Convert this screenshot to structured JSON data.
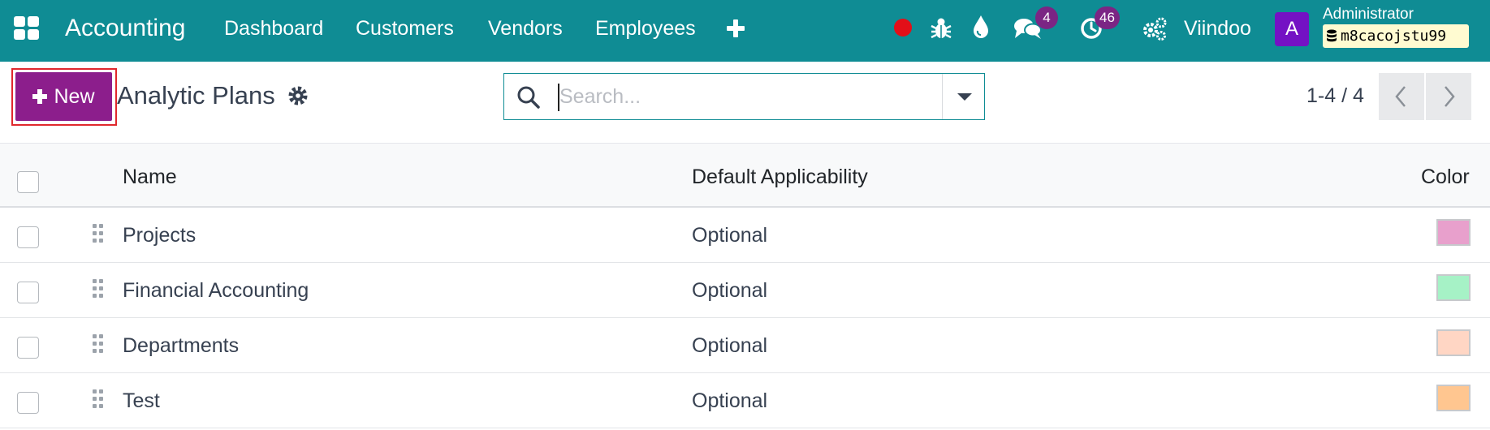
{
  "navbar": {
    "app_name": "Accounting",
    "menu": [
      "Dashboard",
      "Customers",
      "Vendors",
      "Employees"
    ],
    "icons": [
      "apps-grid-icon",
      "plus-icon",
      "record-dot-icon",
      "bug-icon",
      "drop-icon",
      "chat-icon",
      "clock-icon",
      "settings-gears-icon"
    ],
    "messages_count": "4",
    "activities_count": "46",
    "company": "Viindoo",
    "avatar_letter": "A",
    "user": "Administrator",
    "database": "m8cacojstu99",
    "colors": {
      "bar": "#0f8c94",
      "badge": "#7b2584",
      "avatar": "#7411c4",
      "record": "#e30f18"
    }
  },
  "control_panel": {
    "new_label": "New",
    "title": "Analytic Plans",
    "search_placeholder": "Search...",
    "pager": "1-4 / 4",
    "colors": {
      "new_button": "#8c1e8c"
    }
  },
  "table": {
    "columns": [
      "Name",
      "Default Applicability",
      "Color"
    ],
    "rows": [
      {
        "name": "Projects",
        "applicability": "Optional",
        "color": "#e8a0cc"
      },
      {
        "name": "Financial Accounting",
        "applicability": "Optional",
        "color": "#a6f2c6"
      },
      {
        "name": "Departments",
        "applicability": "Optional",
        "color": "#ffd6c4"
      },
      {
        "name": "Test",
        "applicability": "Optional",
        "color": "#ffc690"
      }
    ]
  }
}
